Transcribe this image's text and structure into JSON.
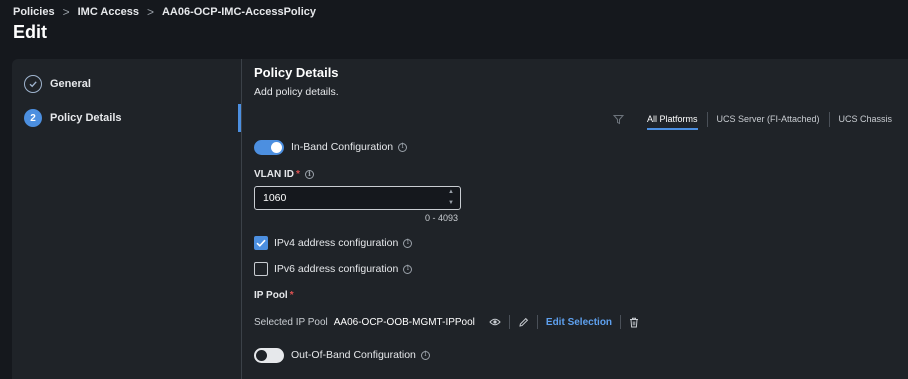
{
  "breadcrumb": {
    "items": [
      "Policies",
      "IMC Access",
      "AA06-OCP-IMC-AccessPolicy"
    ],
    "separator": ">"
  },
  "page": {
    "title": "Edit"
  },
  "steps": [
    {
      "label": "General",
      "state": "completed",
      "icon": "check-icon"
    },
    {
      "label": "Policy Details",
      "number": "2",
      "state": "active"
    }
  ],
  "section": {
    "title": "Policy Details",
    "subtitle": "Add policy details."
  },
  "platform_tabs": {
    "items": [
      "All Platforms",
      "UCS Server (FI-Attached)",
      "UCS Chassis"
    ],
    "active": "All Platforms"
  },
  "inband": {
    "label": "In-Band Configuration",
    "enabled": true
  },
  "vlan": {
    "label": "VLAN ID",
    "required_mark": "*",
    "value": "1060",
    "range_hint": "0 - 4093"
  },
  "ipv4": {
    "label": "IPv4 address configuration",
    "checked": true
  },
  "ipv6": {
    "label": "IPv6 address configuration",
    "checked": false
  },
  "ip_pool": {
    "label": "IP Pool",
    "required_mark": "*",
    "selected_label": "Selected IP Pool",
    "selected_value": "AA06-OCP-OOB-MGMT-IPPool",
    "edit_selection": "Edit Selection"
  },
  "out_of_band": {
    "label": "Out-Of-Band Configuration",
    "enabled": false
  },
  "colors": {
    "accent": "#4c8fe0",
    "background": "#15181d",
    "panel": "#1f2328",
    "required": "#e05252",
    "link": "#5ea0ee"
  }
}
